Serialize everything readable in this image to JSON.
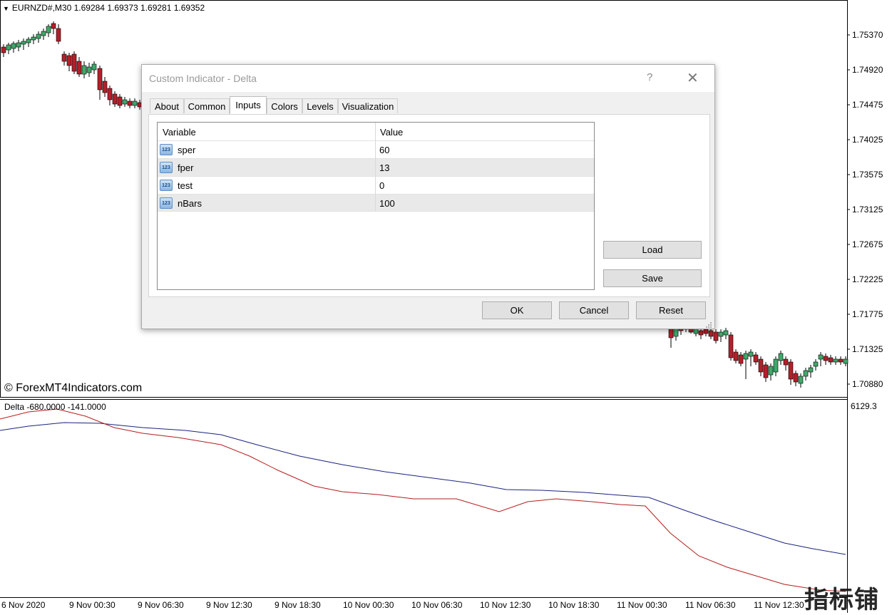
{
  "chart": {
    "symbol_info": "EURNZD#,M30  1.69284 1.69373 1.69281 1.69352",
    "watermark": "© ForexMT4Indicators.com",
    "indicator_label": "Delta -680.0000 -141.0000",
    "indicator_level": "6129.3",
    "price_levels": [
      "1.75370",
      "1.74920",
      "1.74475",
      "1.74025",
      "1.73575",
      "1.73125",
      "1.72675",
      "1.72225",
      "1.71775",
      "1.71325",
      "1.70880"
    ],
    "time_labels": [
      "6 Nov 2020",
      "9 Nov 00:30",
      "9 Nov 06:30",
      "9 Nov 12:30",
      "9 Nov 18:30",
      "10 Nov 00:30",
      "10 Nov 06:30",
      "10 Nov 12:30",
      "10 Nov 18:30",
      "11 Nov 00:30",
      "11 Nov 06:30",
      "11 Nov 12:30"
    ],
    "corner_logo": "指标铺",
    "colors": {
      "bull": "#3fa96a",
      "bear": "#b3202a",
      "blue_line": "#1a237e",
      "red_line": "#b71c1c"
    }
  },
  "dialog": {
    "title": "Custom Indicator - Delta",
    "help": "?",
    "close": "✕",
    "tabs": [
      "About",
      "Common",
      "Inputs",
      "Colors",
      "Levels",
      "Visualization"
    ],
    "active_tab": "Inputs",
    "columns": [
      "Variable",
      "Value"
    ],
    "rows": [
      {
        "icon": "123",
        "variable": "sper",
        "value": "60"
      },
      {
        "icon": "123",
        "variable": "fper",
        "value": "13"
      },
      {
        "icon": "123",
        "variable": "test",
        "value": "0"
      },
      {
        "icon": "123",
        "variable": "nBars",
        "value": "100"
      }
    ],
    "load": "Load",
    "save": "Save",
    "ok": "OK",
    "cancel": "Cancel",
    "reset": "Reset"
  }
}
